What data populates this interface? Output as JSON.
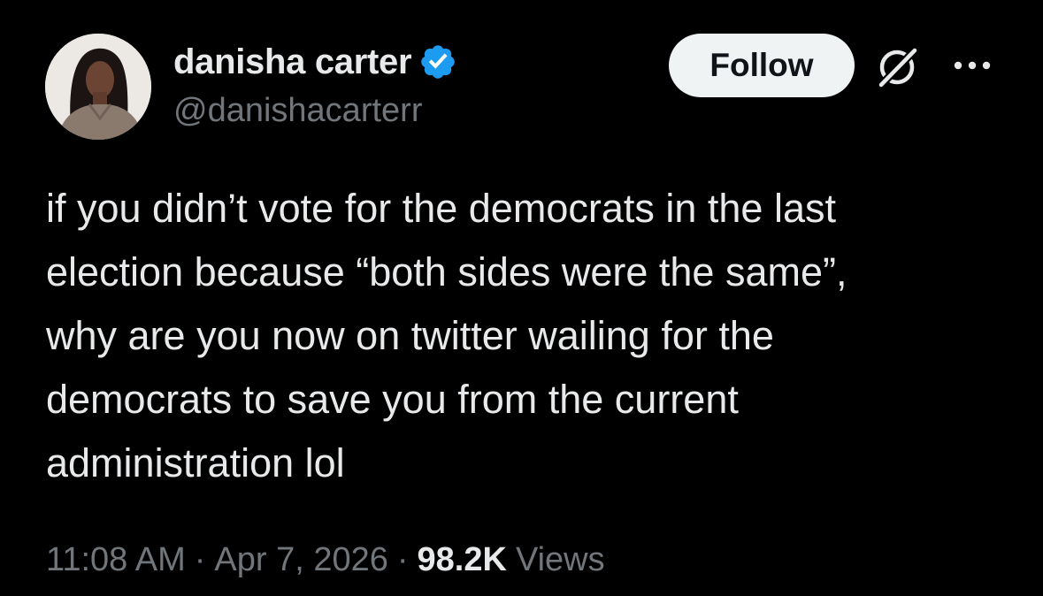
{
  "author": {
    "display_name": "danisha carter",
    "handle": "@danishacarterr",
    "verified": true,
    "avatar_icon": "profile-photo-avatar"
  },
  "header": {
    "follow_label": "Follow",
    "grok_icon": "grok-icon",
    "more_icon": "more-options-icon"
  },
  "tweet": {
    "lines": [
      "if you didn’t vote for the democrats in the last",
      "election because “both sides were the same”,",
      "why are you now on twitter wailing for the",
      "democrats to save you from the current",
      "administration lol"
    ]
  },
  "meta": {
    "time": "11:08 AM",
    "separator": "·",
    "date": "Apr 7, 2026",
    "views_count": "98.2K",
    "views_label": "Views"
  },
  "colors": {
    "background": "#000000",
    "text_primary": "#e7e9ea",
    "text_secondary": "#71767b",
    "verified_blue": "#1d9bf0",
    "follow_bg": "#eff3f4"
  }
}
